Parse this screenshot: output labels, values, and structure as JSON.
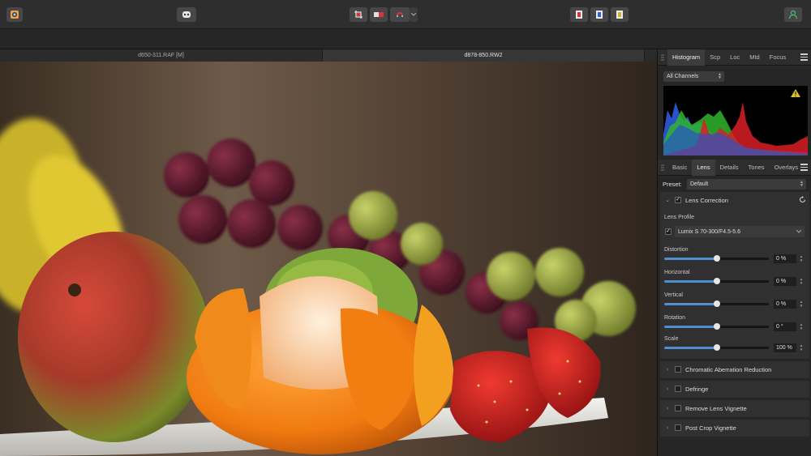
{
  "documents": {
    "tabs": [
      {
        "label": "d650-311.RAF [M]",
        "active": false
      },
      {
        "label": "d878-850.RW2",
        "active": true
      }
    ]
  },
  "panel_top": {
    "tabs": [
      "Histogram",
      "Scp",
      "Loc",
      "Mtd",
      "Focus"
    ],
    "active": "Histogram",
    "channel_select": "All Channels"
  },
  "panel_lens": {
    "tabs": [
      "Basic",
      "Lens",
      "Details",
      "Tones",
      "Overlays"
    ],
    "active": "Lens",
    "preset_label": "Preset:",
    "preset_value": "Default",
    "lens_correction": {
      "title": "Lens Correction",
      "enabled": true,
      "profile_label": "Lens Profile",
      "profile_value": "Lumix S 70-300/F4.5-5.6",
      "sliders": [
        {
          "label": "Distortion",
          "value": "0 %",
          "position": 0.5
        },
        {
          "label": "Horizontal",
          "value": "0 %",
          "position": 0.5
        },
        {
          "label": "Vertical",
          "value": "0 %",
          "position": 0.5
        },
        {
          "label": "Rotation",
          "value": "0 °",
          "position": 0.5
        },
        {
          "label": "Scale",
          "value": "100 %",
          "position": 0.5
        }
      ]
    },
    "sections": [
      {
        "title": "Chromatic Aberration Reduction",
        "enabled": false
      },
      {
        "title": "Defringe",
        "enabled": false
      },
      {
        "title": "Remove Lens Vignette",
        "enabled": false
      },
      {
        "title": "Post Crop Vignette",
        "enabled": false
      }
    ]
  },
  "colors": {
    "accent": "#4f8ed0",
    "histogram_red": "#d81f26",
    "histogram_green": "#2fb52c",
    "histogram_blue": "#2a52c8",
    "warning": "#e0c02a"
  }
}
